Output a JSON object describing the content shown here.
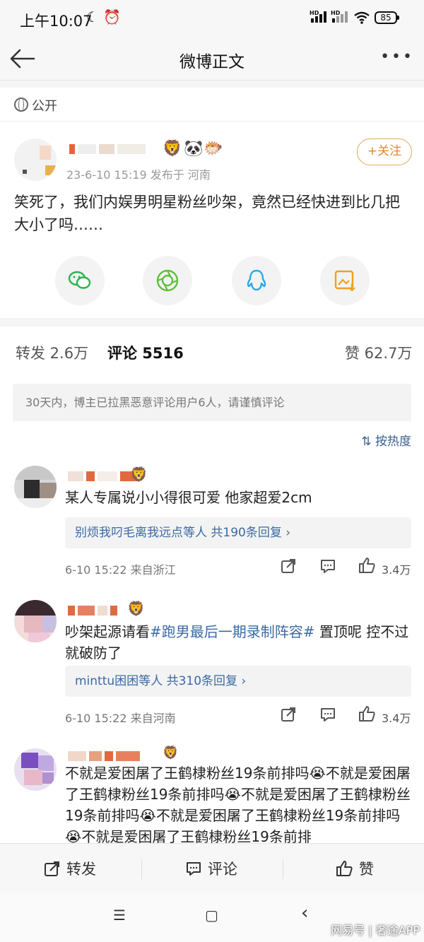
{
  "status_bar": {
    "time": "上午10:07",
    "battery": "85",
    "hd1": "HD",
    "hd2": "HD"
  },
  "header": {
    "title": "微博正文"
  },
  "visibility": {
    "label": "公开"
  },
  "post": {
    "meta": "23-6-10 15:19  发布于 河南",
    "follow_label": "+关注",
    "text": "笑死了，我们内娱男明星粉丝吵架，竟然已经快进到比几把大小了吗……"
  },
  "share": {
    "icons": [
      "wechat-icon",
      "moments-icon",
      "qq-icon",
      "save-image-icon"
    ]
  },
  "tabs": {
    "repost": "转发 2.6万",
    "comment": "评论 5516",
    "like": "赞 62.7万"
  },
  "notice": "30天内，博主已拉黑恶意评论用户6人，请谨慎评论",
  "sort_label": "按热度",
  "comments": [
    {
      "text": "某人专属说小小得很可爱 他家超爱2cm",
      "reply_summary": "别烦我叼毛离我远点等人  共190条回复 ›",
      "meta": "6-10 15:22  来自浙江",
      "likes": "3.4万"
    },
    {
      "text_a": "吵架起源请看",
      "hashtag": "#跑男最后一期录制阵容#",
      "text_b": " 置顶呢 控不过就破防了",
      "reply_summary": "minttu困困等人  共310条回复 ›",
      "meta": "6-10 15:22  来自河南",
      "likes": "3.4万"
    },
    {
      "text": "不就是爱困屠了王鹤棣粉丝19条前排吗😭不就是爱困屠了王鹤棣粉丝19条前排吗😭不就是爱困屠了王鹤棣粉丝19条前排吗😭不就是爱困屠了王鹤棣粉丝19条前排吗😭不就是爱困屠了王鹤棣粉丝19条前排"
    }
  ],
  "bottom_bar": {
    "repost": "转发",
    "comment": "评论",
    "like": "赞"
  },
  "nav": {
    "menu": "☰",
    "home": "▢",
    "back": "‹"
  },
  "watermark": "网易号 | 奢途APP",
  "colors": {
    "accent_link": "#3a6aa5",
    "follow": "#e08a2a",
    "wechat": "#2bb34f",
    "qq": "#2aa8e8",
    "save": "#f0a020"
  }
}
